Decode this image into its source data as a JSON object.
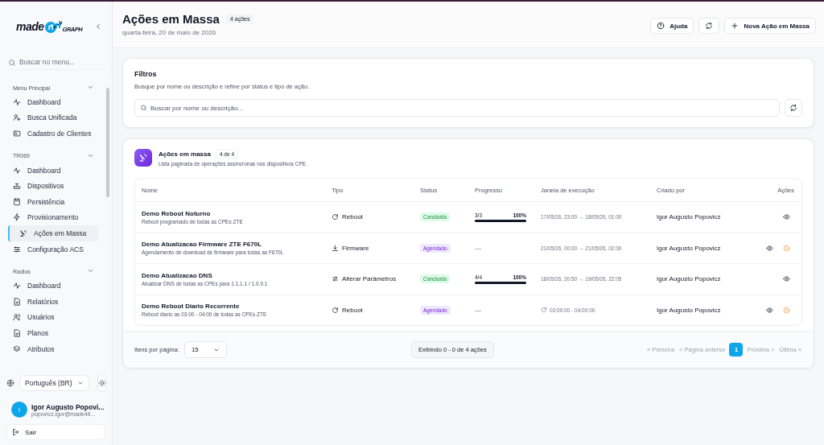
{
  "sidebar": {
    "logo": {
      "main": "made",
      "accent": "GRAPH"
    },
    "search": {
      "placeholder": "Buscar no menu..."
    },
    "sections": [
      {
        "title": "Menu Principal",
        "expanded": true,
        "items": [
          {
            "label": "Dashboard",
            "kind": "pulse",
            "selected": false
          },
          {
            "label": "Busca Unificada",
            "kind": "user-search",
            "selected": false
          },
          {
            "label": "Cadastro de Clientes",
            "kind": "card",
            "selected": false
          }
        ]
      },
      {
        "title": "TR069",
        "expanded": true,
        "items": [
          {
            "label": "Dashboard",
            "kind": "pulse",
            "selected": false
          },
          {
            "label": "Dispositivos",
            "kind": "router",
            "selected": false
          },
          {
            "label": "Persistência",
            "kind": "save",
            "selected": false
          },
          {
            "label": "Provisionamento",
            "kind": "bolt",
            "selected": false
          },
          {
            "label": "Ações em Massa",
            "kind": "broadcast",
            "selected": true
          },
          {
            "label": "Configuração ACS",
            "kind": "sliders",
            "selected": false
          }
        ]
      },
      {
        "title": "Radius",
        "expanded": true,
        "items": [
          {
            "label": "Dashboard",
            "kind": "pulse",
            "selected": false
          },
          {
            "label": "Relatórios",
            "kind": "doc",
            "selected": false
          },
          {
            "label": "Usuários",
            "kind": "users",
            "selected": false
          },
          {
            "label": "Planos",
            "kind": "doc",
            "selected": false
          },
          {
            "label": "Atributos",
            "kind": "layers",
            "selected": false
          }
        ]
      }
    ],
    "language": "Português (BR)",
    "user": {
      "initial": "I",
      "name": "Igor Augusto Popovi...",
      "email": "popovicz.igor@made4it..."
    },
    "logout": "Sair"
  },
  "header": {
    "title": "Ações em Massa",
    "count": "4 ações",
    "date": "quarta-feira, 20 de maio de 2026",
    "help": "Ajuda",
    "new": "Nova Ação em Massa"
  },
  "filters": {
    "title": "Filtros",
    "subtitle": "Busque por nome ou descrição e refine por status e tipo de ação.",
    "placeholder": "Buscar por nome ou descrição..."
  },
  "table": {
    "title": "Ações em massa",
    "count": "4 de 4",
    "subtitle": "Lista paginada de operações assíncronas nos dispositivos CPE.",
    "columns": [
      "Nome",
      "Tipo",
      "Status",
      "Progresso",
      "Janela de execução",
      "Criado por",
      "Ações"
    ],
    "rows": [
      {
        "name": "Demo Reboot Noturno",
        "description": "Reboot programado de todas as CPEs ZTE",
        "type": {
          "kind": "reboot",
          "label": "Reboot"
        },
        "status": {
          "kind": "done",
          "label": "Concluído"
        },
        "progress": {
          "count": "3/3",
          "percent": "100%",
          "level": 1
        },
        "window": {
          "kind": "range",
          "text": "17/05/26, 23:00 → 18/05/26, 01:00"
        },
        "creator": "Igor Augusto Popovicz",
        "actions": [
          {
            "kind": "view"
          }
        ]
      },
      {
        "name": "Demo Atualizacao Firmware ZTE F670L",
        "description": "Agendamento de download de firmware para todas as F670L",
        "type": {
          "kind": "firmware",
          "label": "Firmware"
        },
        "status": {
          "kind": "scheduled",
          "label": "Agendado"
        },
        "progress": {
          "empty": "—"
        },
        "window": {
          "kind": "range",
          "text": "21/05/26, 00:00 → 21/05/26, 02:00"
        },
        "creator": "Igor Augusto Popovicz",
        "actions": [
          {
            "kind": "view"
          },
          {
            "kind": "cancel"
          }
        ]
      },
      {
        "name": "Demo Atualizacao DNS",
        "description": "Atualizar DNS de todas as CPEs para 1.1.1.1 / 1.0.0.1",
        "type": {
          "kind": "params",
          "label": "Alterar Parâmetros"
        },
        "status": {
          "kind": "done",
          "label": "Concluído"
        },
        "progress": {
          "count": "4/4",
          "percent": "100%",
          "level": 1
        },
        "window": {
          "kind": "range",
          "text": "18/05/26, 20:50 → 19/05/26, 22:05"
        },
        "creator": "Igor Augusto Popovicz",
        "actions": [
          {
            "kind": "view"
          }
        ]
      },
      {
        "name": "Demo Reboot Diario Recorrente",
        "description": "Reboot diario as 03:00 - 04:00 de todas as CPEs ZTE",
        "type": {
          "kind": "reboot",
          "label": "Reboot"
        },
        "status": {
          "kind": "scheduled",
          "label": "Agendado"
        },
        "progress": {
          "empty": "—"
        },
        "window": {
          "kind": "recurring",
          "text": "03:00:00 - 04:00:00"
        },
        "creator": "Igor Augusto Popovicz",
        "actions": [
          {
            "kind": "view"
          },
          {
            "kind": "cancel"
          }
        ]
      }
    ]
  },
  "pagination": {
    "per_page_label": "Itens por página:",
    "per_page": "15",
    "summary": "Exibindo 0 - 0 de 4 ações",
    "pages": [
      {
        "label": "« Primeira",
        "selected": false,
        "disabled": true
      },
      {
        "label": "< Página anterior",
        "selected": false,
        "disabled": true
      },
      {
        "label": "1",
        "selected": true,
        "disabled": false
      },
      {
        "label": "Próxima >",
        "selected": false,
        "disabled": true
      },
      {
        "label": "Última »",
        "selected": false,
        "disabled": true
      }
    ]
  }
}
